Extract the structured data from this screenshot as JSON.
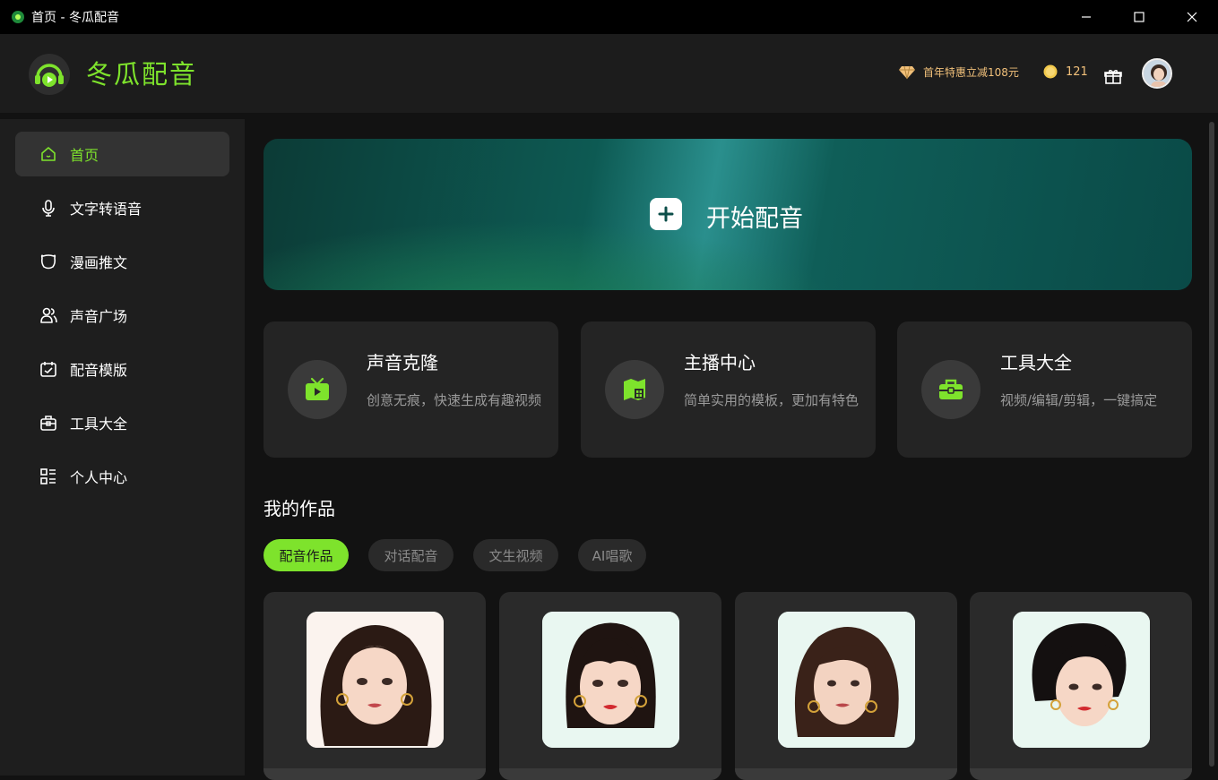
{
  "window": {
    "title": "首页 - 冬瓜配音"
  },
  "header": {
    "brand": "冬瓜配音",
    "promo": "首年特惠立减108元",
    "coins": "121"
  },
  "sidebar": {
    "items": [
      {
        "label": "首页",
        "icon": "home-icon",
        "active": true
      },
      {
        "label": "文字转语音",
        "icon": "microphone-icon"
      },
      {
        "label": "漫画推文",
        "icon": "bear-icon"
      },
      {
        "label": "声音广场",
        "icon": "users-icon"
      },
      {
        "label": "配音模版",
        "icon": "template-icon"
      },
      {
        "label": "工具大全",
        "icon": "toolbox-icon"
      },
      {
        "label": "个人中心",
        "icon": "list-icon"
      }
    ]
  },
  "banner": {
    "label": "开始配音"
  },
  "cards": [
    {
      "title": "声音克隆",
      "desc": "创意无痕，快速生成有趣视频",
      "icon": "tv-icon"
    },
    {
      "title": "主播中心",
      "desc": "简单实用的模板，更加有特色",
      "icon": "map-icon"
    },
    {
      "title": "工具大全",
      "desc": "视频/编辑/剪辑，一键搞定",
      "icon": "briefcase-icon"
    }
  ],
  "works": {
    "title": "我的作品",
    "tabs": [
      {
        "label": "配音作品",
        "active": true
      },
      {
        "label": "对话配音"
      },
      {
        "label": "文生视频"
      },
      {
        "label": "AI唱歌"
      }
    ]
  },
  "colors": {
    "accent": "#7ee32c",
    "promo": "#f1c07a"
  }
}
